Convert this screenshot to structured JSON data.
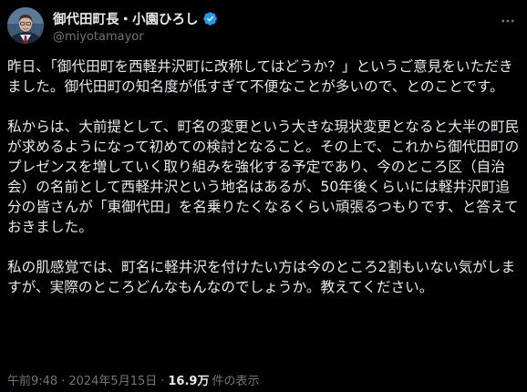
{
  "author": {
    "display_name": "御代田町長・小園ひろし",
    "handle": "@miyotamayor",
    "verified": true
  },
  "post": {
    "paragraphs": [
      "昨日、「御代田町を西軽井沢町に改称してはどうか？」というご意見をいただきました。御代田町の知名度が低すぎて不便なことが多いので、とのことです。",
      "私からは、大前提として、町名の変更という大きな現状変更となると大半の町民が求めるようになって初めての検討となること。その上で、これから御代田町のプレゼンスを増していく取り組みを強化する予定であり、今のところ区（自治会）の名前として西軽井沢という地名はあるが、50年後くらいには軽井沢町追分の皆さんが「東御代田」を名乗りたくなるくらい頑張るつもりです、と答えておきました。",
      "私の肌感覚では、町名に軽井沢を付けたい方は今のところ2割もいない気がしますが、実際のところどんなもんなのでしょうか。教えてください。"
    ]
  },
  "meta": {
    "time": "午前9:48",
    "separator": "·",
    "date": "2024年5月15日",
    "views_count": "16.9万",
    "views_label": "件の表示"
  },
  "colors": {
    "background": "#000000",
    "text": "#e7e9ea",
    "secondary": "#71767b",
    "verified": "#1d9bf0"
  },
  "icons": {
    "verified": "verified-badge-icon",
    "more": "more-options-icon"
  }
}
